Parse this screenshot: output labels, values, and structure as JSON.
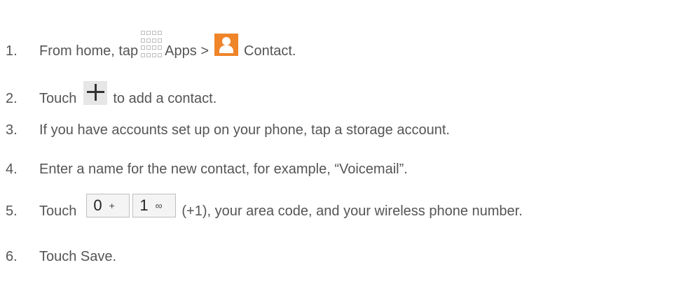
{
  "steps": [
    {
      "num": "1.",
      "parts": {
        "a": "From home, tap",
        "b": "Apps >",
        "c": "Contact."
      }
    },
    {
      "num": "2.",
      "parts": {
        "a": "Touch",
        "b": "to add a contact."
      }
    },
    {
      "num": "3.",
      "parts": {
        "a": "If you have accounts set up on your phone, tap a storage account."
      }
    },
    {
      "num": "4.",
      "parts": {
        "a": "Enter a name for the new contact, for example, “Voicemail”."
      }
    },
    {
      "num": "5.",
      "parts": {
        "a": "Touch",
        "key1_main": "0",
        "key1_sub": "+",
        "key2_main": "1",
        "key2_sub": "∞",
        "b": "(+1), your area code, and your wireless phone number."
      }
    },
    {
      "num": "6.",
      "parts": {
        "a": "Touch Save."
      }
    }
  ],
  "icons": {
    "apps": "apps-grid-icon",
    "contact": "contact-icon",
    "plus": "plus-icon"
  },
  "colors": {
    "text": "#555555",
    "contact_bg": "#ef8429",
    "plus_bg": "#e6e6e6"
  }
}
